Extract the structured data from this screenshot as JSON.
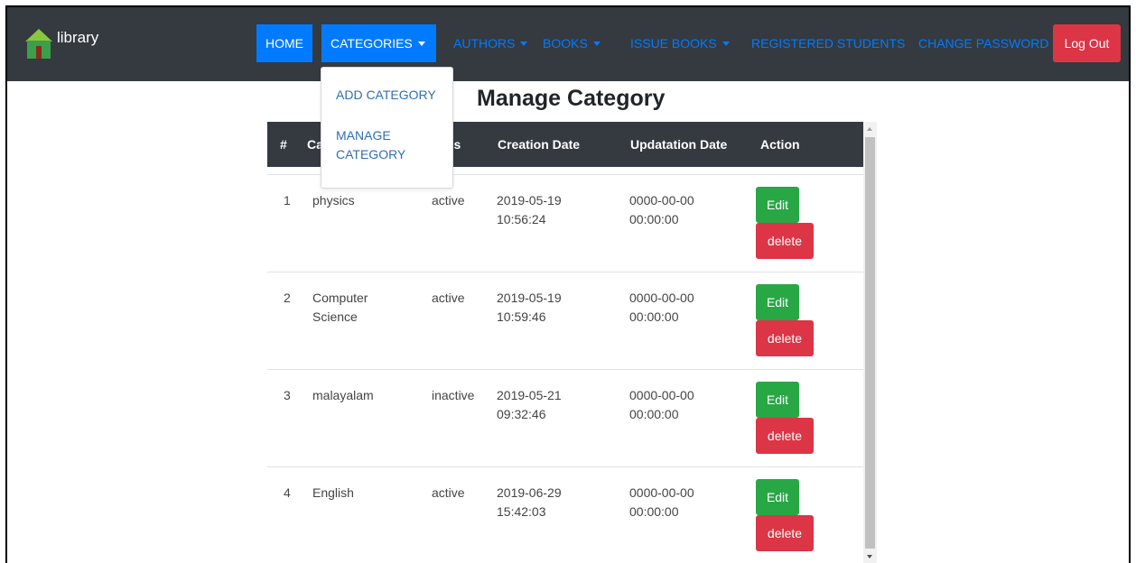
{
  "brand": {
    "name": "library",
    "logo_icon": "book-house-icon"
  },
  "nav": {
    "home": "HOME",
    "categories": "CATEGORIES",
    "authors": "AUTHORS",
    "books": "BOOKS",
    "issue_books": "ISSUE BOOKS",
    "registered_students": "REGISTERED STUDENTS",
    "change_password": "CHANGE PASSWORD",
    "logout": "Log Out"
  },
  "dropdown": {
    "items": [
      "ADD CATEGORY",
      "MANAGE CATEGORY"
    ]
  },
  "page": {
    "title": "Manage Category"
  },
  "table": {
    "headers": [
      "#",
      "Category",
      "Status",
      "Creation Date",
      "Updatation Date",
      "Action"
    ],
    "header_visible": {
      "category": "Ca",
      "status": "us"
    },
    "rows": [
      {
        "num": "1",
        "category": "physics",
        "status": "active",
        "creation": "2019-05-19 10:56:24",
        "updation": "0000-00-00 00:00:00",
        "edit": "Edit",
        "delete": "delete"
      },
      {
        "num": "2",
        "category": "Computer Science",
        "status": "active",
        "creation": "2019-05-19 10:59:46",
        "updation": "0000-00-00 00:00:00",
        "edit": "Edit",
        "delete": "delete"
      },
      {
        "num": "3",
        "category": "malayalam",
        "status": "inactive",
        "creation": "2019-05-21 09:32:46",
        "updation": "0000-00-00 00:00:00",
        "edit": "Edit",
        "delete": "delete"
      },
      {
        "num": "4",
        "category": "English",
        "status": "active",
        "creation": "2019-06-29 15:42:03",
        "updation": "0000-00-00 00:00:00",
        "edit": "Edit",
        "delete": "delete"
      }
    ]
  },
  "colors": {
    "navbar": "#343a40",
    "primary": "#007bff",
    "success": "#28a745",
    "danger": "#dc3545"
  }
}
